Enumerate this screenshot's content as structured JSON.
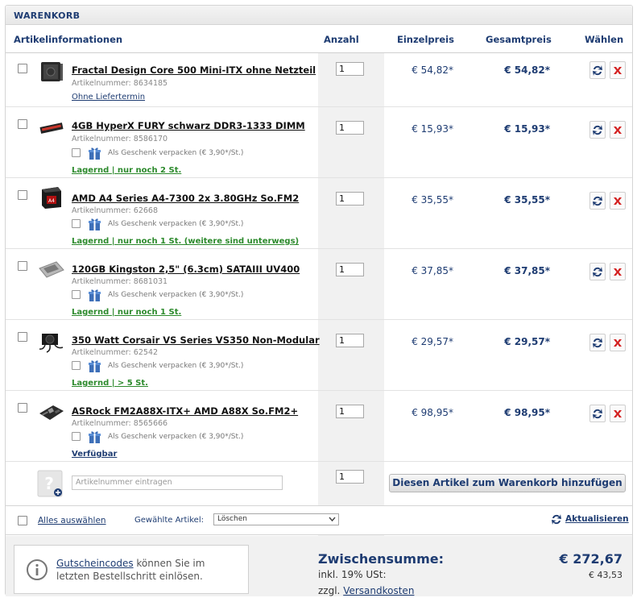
{
  "title": "WARENKORB",
  "columns": {
    "info": "Artikelinformationen",
    "qty": "Anzahl",
    "unit": "Einzelpreis",
    "total": "Gesamtpreis",
    "choose": "Wählen"
  },
  "items": [
    {
      "name": "Fractal Design Core 500 Mini-ITX ohne Netzteil",
      "artno": "Artikelnummer: 8634185",
      "gift": "",
      "availability": "Ohne Liefertermin",
      "qty": "1",
      "unit_price": "€ 54,82*",
      "total_price": "€ 54,82*",
      "thumb_icon": "pc-case-icon"
    },
    {
      "name": "4GB HyperX FURY schwarz DDR3-1333 DIMM",
      "artno": "Artikelnummer: 8586170",
      "gift": "Als Geschenk verpacken (€ 3,90*/St.)",
      "availability": "Lagernd | nur noch 2 St.",
      "qty": "1",
      "unit_price": "€ 15,93*",
      "total_price": "€ 15,93*",
      "thumb_icon": "ram-icon"
    },
    {
      "name": "AMD A4 Series A4-7300 2x 3.80GHz So.FM2",
      "artno": "Artikelnummer: 62668",
      "gift": "Als Geschenk verpacken (€ 3,90*/St.)",
      "availability": "Lagernd | nur noch 1 St. (weitere sind unterwegs)",
      "qty": "1",
      "unit_price": "€ 35,55*",
      "total_price": "€ 35,55*",
      "thumb_icon": "cpu-box-icon"
    },
    {
      "name": "120GB Kingston 2,5\" (6.3cm) SATAIII UV400",
      "artno": "Artikelnummer: 8681031",
      "gift": "Als Geschenk verpacken (€ 3,90*/St.)",
      "availability": "Lagernd | nur noch 1 St.",
      "qty": "1",
      "unit_price": "€ 37,85*",
      "total_price": "€ 37,85*",
      "thumb_icon": "ssd-icon"
    },
    {
      "name": "350 Watt Corsair VS Series VS350 Non-Modular",
      "artno": "Artikelnummer: 62542",
      "gift": "Als Geschenk verpacken (€ 3,90*/St.)",
      "availability": "Lagernd | > 5 St.",
      "qty": "1",
      "unit_price": "€ 29,57*",
      "total_price": "€ 29,57*",
      "thumb_icon": "psu-icon"
    },
    {
      "name": "ASRock FM2A88X-ITX+ AMD A88X So.FM2+",
      "artno": "Artikelnummer: 8565666",
      "gift": "Als Geschenk verpacken (€ 3,90*/St.)",
      "availability": "Verfügbar",
      "qty": "1",
      "unit_price": "€ 98,95*",
      "total_price": "€ 98,95*",
      "thumb_icon": "mainboard-icon"
    }
  ],
  "add_item": {
    "placeholder": "Artikelnummer eintragen",
    "qty": "1",
    "button": "Diesen Artikel zum Warenkorb hinzufügen"
  },
  "actions": {
    "select_all": "Alles auswählen",
    "selected_label": "Gewählte Artikel:",
    "selected_option": "Löschen",
    "refresh": "Aktualisieren"
  },
  "voucher": {
    "link": "Gutscheincodes",
    "line1_rest": " können Sie im",
    "line2": "letzten Bestellschritt einlösen."
  },
  "summary": {
    "subtotal_label": "Zwischensumme:",
    "subtotal_value": "€ 272,67",
    "tax_label": "inkl. 19% USt:",
    "tax_value": "€ 43,53",
    "shipping_prefix": "zzgl. ",
    "shipping_link": "Versandkosten"
  },
  "colors": {
    "accent": "#1e3c72",
    "stock_green": "#2c8a2c",
    "delete_red": "#d42020"
  }
}
